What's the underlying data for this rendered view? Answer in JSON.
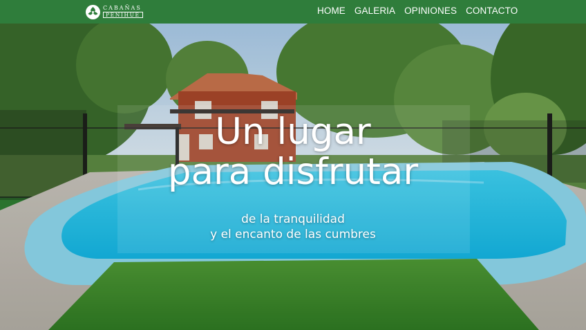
{
  "brand": {
    "line1": "CABAÑAS",
    "line2": "PEÑIHUE",
    "icon": "leaf-emblem-icon"
  },
  "nav": {
    "items": [
      {
        "label": "HOME"
      },
      {
        "label": "GALERIA"
      },
      {
        "label": "OPINIONES"
      },
      {
        "label": "CONTACTO"
      }
    ]
  },
  "hero": {
    "title_line1": "Un lugar",
    "title_line2": "para disfrutar",
    "subtitle_line1": "de la tranquilidad",
    "subtitle_line2": "y el encanto de las cumbres"
  },
  "colors": {
    "navbar": "#2f7d3b",
    "pool_water": "#22c3e8",
    "pool_edge": "#8fd8ee",
    "grass": "#3e8a2c",
    "house_brick": "#b84a2c"
  }
}
